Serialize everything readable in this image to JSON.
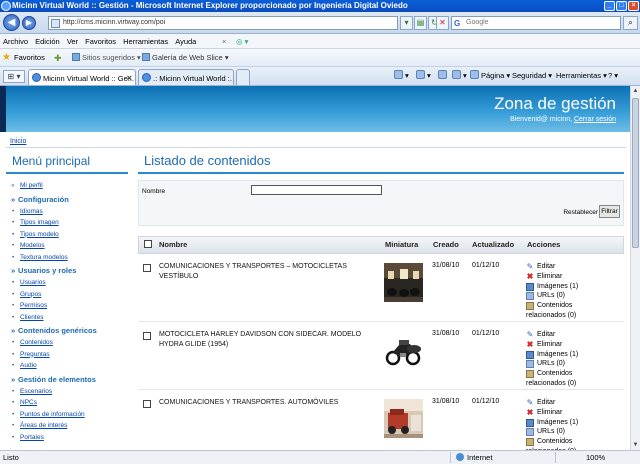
{
  "window": {
    "title": "Micinn Virtual World :: Gestión - Microsoft Internet Explorer proporcionado por Ingeniería Digital Oviedo"
  },
  "address": {
    "url": "http://cms.micinn.virtway.com/poi",
    "search_placeholder": "Google"
  },
  "menu": [
    "Archivo",
    "Edición",
    "Ver",
    "Favoritos",
    "Herramientas",
    "Ayuda"
  ],
  "favorites": {
    "label": "Favoritos",
    "suggested": "Sitios sugeridos ▾",
    "slice": "Galería de Web Slice ▾"
  },
  "tabs": [
    {
      "label": "Micinn Virtual World :: Ge..."
    },
    {
      "label": ".: Micinn Virtual World :."
    }
  ],
  "commands": {
    "page": "Página ▾",
    "security": "Seguridad ▾",
    "tools": "Herramientas ▾",
    "help": "? ▾"
  },
  "banner": {
    "title": "Zona de gestión",
    "welcome": "Bienvenid@ micinn,",
    "logout": "Cerrar sesión"
  },
  "breadcrumb": "Inicio",
  "sidebar": {
    "title": "Menú principal",
    "profile": "Mi perfil",
    "groups": [
      {
        "heading": "Configuración",
        "items": [
          "Idiomas",
          "Tipos imagen",
          "Tipos modelo",
          "Modelos",
          "Textura modelos"
        ]
      },
      {
        "heading": "Usuarios y roles",
        "items": [
          "Usuarios",
          "Grupos",
          "Permisos",
          "Clientes"
        ]
      },
      {
        "heading": "Contenidos genéricos",
        "items": [
          "Contenidos",
          "Preguntas",
          "Audio"
        ]
      },
      {
        "heading": "Gestión de elementos",
        "items": [
          "Escenarios",
          "NPCs",
          "Puntos de información",
          "Áreas de interés",
          "Portales"
        ]
      }
    ]
  },
  "main": {
    "title": "Listado de contenidos",
    "filter": {
      "name_label": "Nombre",
      "reset": "Restablecer",
      "submit": "Filtrar"
    },
    "columns": {
      "name": "Nombre",
      "thumb": "Miniatura",
      "created": "Creado",
      "updated": "Actualizado",
      "actions": "Acciones"
    },
    "rows": [
      {
        "name": "COMUNICACIONES Y TRANSPORTES – MOTOCICLETAS VESTÍBULO",
        "created": "31/08/10",
        "updated": "01/12/10"
      },
      {
        "name": "MOTOCICLETA HARLEY DAVIDSON CON SIDECAR. MODELO HYDRA GLIDE (1954)",
        "created": "31/08/10",
        "updated": "01/12/10"
      },
      {
        "name": "COMUNICACIONES Y TRANSPORTES. AUTOMÓVILES",
        "created": "31/08/10",
        "updated": "01/12/10"
      }
    ],
    "actions": {
      "edit": "Editar",
      "delete": "Eliminar",
      "images": "Imágenes (1)",
      "urls": "URLs (0)",
      "related_1": "Contenidos",
      "related_2": "relacionados (0)"
    }
  },
  "status": {
    "left": "Listo",
    "zone": "Internet",
    "zoom": "100%"
  }
}
